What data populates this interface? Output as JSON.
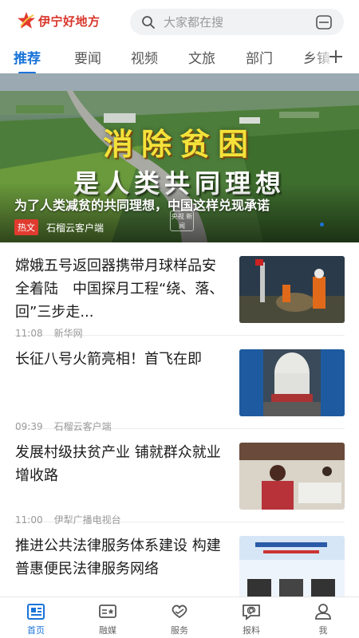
{
  "header": {
    "brand": "伊宁好地方",
    "search_placeholder": "大家都在搜"
  },
  "tabs": [
    {
      "label": "推荐",
      "active": true
    },
    {
      "label": "要闻"
    },
    {
      "label": "视频"
    },
    {
      "label": "文旅"
    },
    {
      "label": "部门"
    },
    {
      "label": "乡镇"
    }
  ],
  "hero": {
    "overlay_line1": "消除贫困",
    "overlay_line2": "是人类共同理想",
    "title": "为了人类减贫的共同理想，中国这样兑现承诺",
    "badge": "热文",
    "source": "石榴云客户端",
    "watermark": "央视 新闻"
  },
  "news": [
    {
      "title": "嫦娥五号返回器携带月球样品安全着陆　中国探月工程“绕、落、回”三步走...",
      "time": "11:08",
      "source": "新华网"
    },
    {
      "title": "长征八号火箭亮相！首飞在即",
      "time": "09:39",
      "source": "石榴云客户端"
    },
    {
      "title": "发展村级扶贫产业 铺就群众就业增收路",
      "time": "11:00",
      "source": "伊犁广播电视台"
    },
    {
      "title": "推进公共法律服务体系建设 构建普惠便民法律服务网络",
      "time": "",
      "source": ""
    }
  ],
  "bottom_nav": [
    {
      "label": "首页",
      "icon": "newspaper-icon",
      "active": true
    },
    {
      "label": "融媒",
      "icon": "media-card-icon"
    },
    {
      "label": "服务",
      "icon": "heart-hands-icon"
    },
    {
      "label": "报料",
      "icon": "chat-at-icon"
    },
    {
      "label": "我",
      "icon": "user-icon"
    }
  ],
  "colors": {
    "accent": "#1a74d8",
    "brand_red": "#d9362b",
    "hot_badge": "#e03b2f"
  }
}
